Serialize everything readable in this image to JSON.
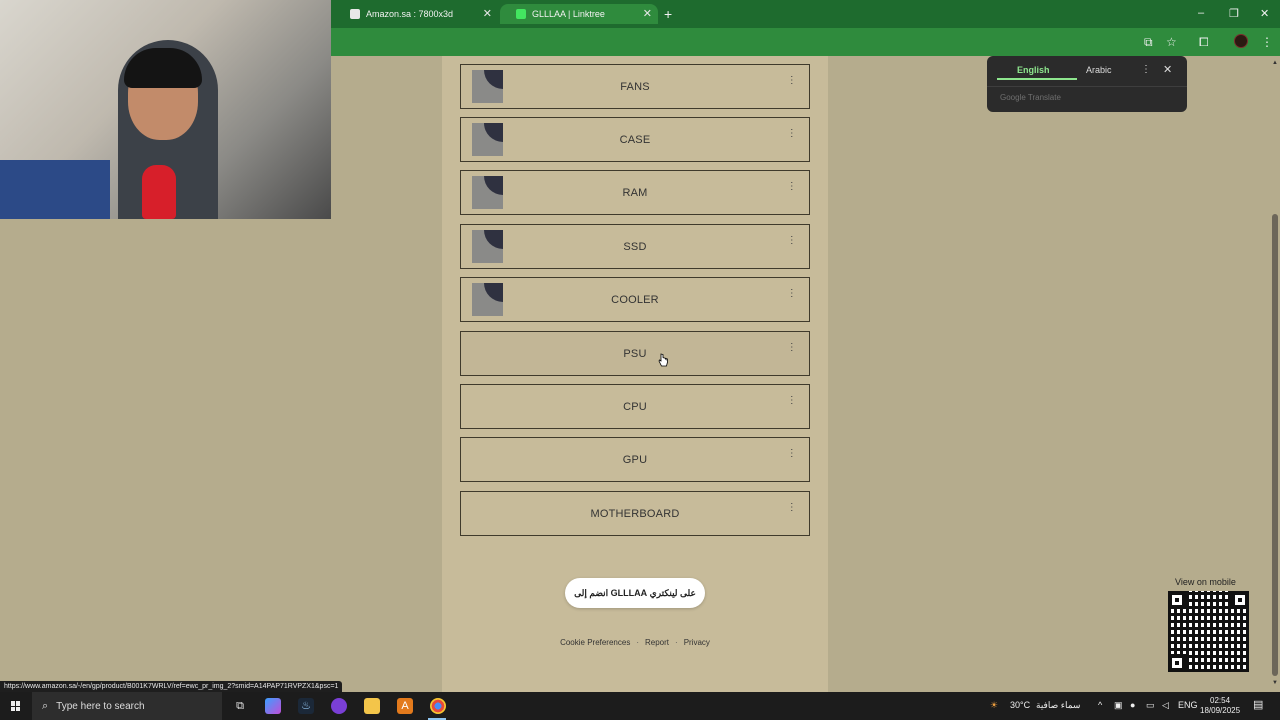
{
  "browser": {
    "tabs": [
      {
        "title": "Amazon.sa : 7800x3d",
        "favicon_color": "#e8e8e8"
      },
      {
        "title": "GLLLAA | Linktree",
        "favicon_color": "#43e660"
      }
    ],
    "new_tab": "+",
    "window_controls": [
      "–",
      "❐",
      "✕"
    ],
    "close_tab": "✕"
  },
  "links": [
    {
      "label": "FANS",
      "has_thumb": true
    },
    {
      "label": "CASE",
      "has_thumb": true
    },
    {
      "label": "RAM",
      "has_thumb": true
    },
    {
      "label": "SSD",
      "has_thumb": true
    },
    {
      "label": "COOLER",
      "has_thumb": true
    },
    {
      "label": "PSU",
      "has_thumb": false
    },
    {
      "label": "CPU",
      "has_thumb": false
    },
    {
      "label": "GPU",
      "has_thumb": false
    },
    {
      "label": "MOTHERBOARD",
      "has_thumb": false
    }
  ],
  "join_button": "على لينكتري GLLLAA انضم إلى",
  "footer": {
    "cookie": "Cookie Preferences",
    "report": "Report",
    "privacy": "Privacy",
    "separator": "·"
  },
  "translate": {
    "english": "English",
    "arabic": "Arabic",
    "brand": "Google Translate",
    "menu": "⋮",
    "close": "✕"
  },
  "qr": {
    "label": "View on mobile"
  },
  "status_url": "https://www.amazon.sa/-/en/gp/product/B001K7WRLV/ref=ewc_pr_img_2?smid=A14PAP71RVPZX1&psc=1",
  "taskbar": {
    "search_placeholder": "Type here to search",
    "weather": "30°C",
    "weather_text": "سماء صافية",
    "language": "ENG",
    "time": "02:54",
    "date": "18/09/2025"
  }
}
